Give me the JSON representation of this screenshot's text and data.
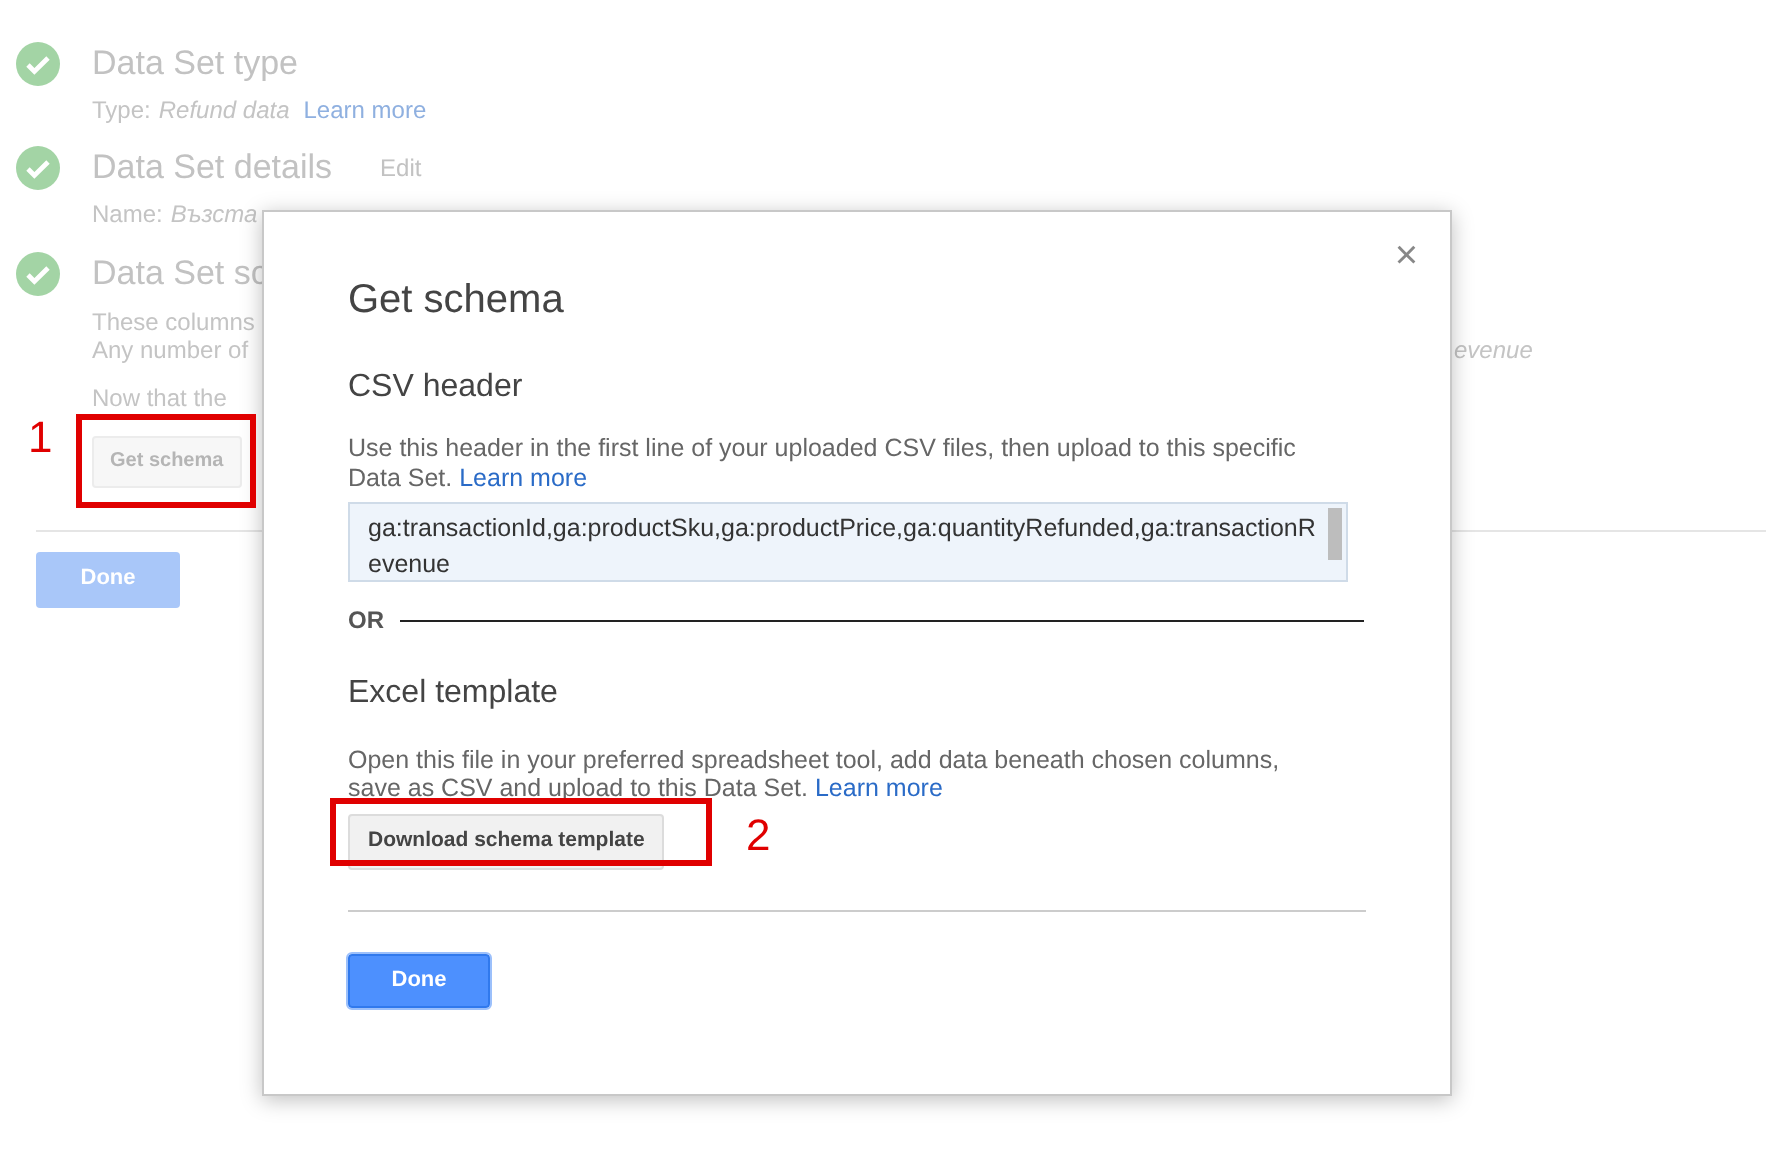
{
  "steps": [
    {
      "title": "Data Set type",
      "done": true,
      "lines": [
        {
          "label": "Type:",
          "value": "Refund data",
          "link": "Learn more"
        }
      ]
    },
    {
      "title": "Data Set details",
      "done": true,
      "edit": "Edit",
      "lines": [
        {
          "label": "Name:",
          "value": "Възста"
        }
      ]
    },
    {
      "title": "Data Set sc",
      "done": true,
      "lines": [
        {
          "label": "These columns"
        },
        {
          "label": "Any number of",
          "value": "evenue"
        },
        {
          "label": "Now that the"
        }
      ]
    }
  ],
  "background_button": "Get schema",
  "background_done": "Done",
  "dialog": {
    "title": "Get schema",
    "close": "×",
    "csv": {
      "heading": "CSV header",
      "text": "Use this header in the first line of your uploaded CSV files, then upload to this specific Data Set.",
      "link": "Learn more",
      "value": "ga:transactionId,ga:productSku,ga:productPrice,ga:quantityRefunded,ga:transactionRevenue"
    },
    "separator": "OR",
    "excel": {
      "heading": "Excel template",
      "text": "Open this file in your preferred spreadsheet tool, add data beneath chosen columns, save as CSV and upload to this Data Set.",
      "link": "Learn more",
      "button": "Download schema template"
    },
    "done": "Done"
  },
  "annotations": [
    "1",
    "2"
  ]
}
